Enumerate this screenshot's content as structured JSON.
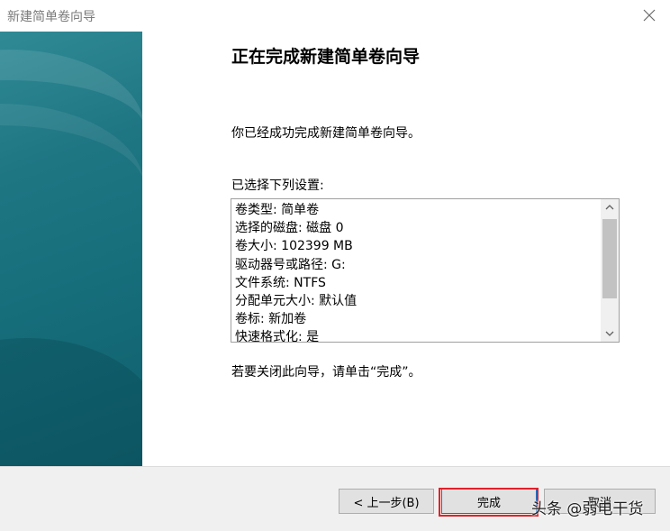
{
  "window": {
    "title": "新建简单卷向导"
  },
  "main": {
    "heading": "正在完成新建简单卷向导",
    "success_text": "你已经成功完成新建简单卷向导。",
    "settings_label": "已选择下列设置:",
    "settings": [
      "卷类型: 简单卷",
      "选择的磁盘: 磁盘 0",
      "卷大小: 102399 MB",
      "驱动器号或路径: G:",
      "文件系统: NTFS",
      "分配单元大小: 默认值",
      "卷标: 新加卷",
      "快速格式化: 是"
    ],
    "close_hint": "若要关闭此向导，请单击“完成”。"
  },
  "footer": {
    "back_label": "< 上一步(B)",
    "finish_label": "完成",
    "cancel_label": "取消"
  },
  "watermark": "头条 @弱电干货",
  "colors": {
    "side_panel": "#1f7683",
    "highlight": "#e0212b",
    "focus": "#0078d7"
  },
  "icons": {
    "close": "close-icon",
    "scroll_up": "chevron-up-icon",
    "scroll_down": "chevron-down-icon"
  }
}
